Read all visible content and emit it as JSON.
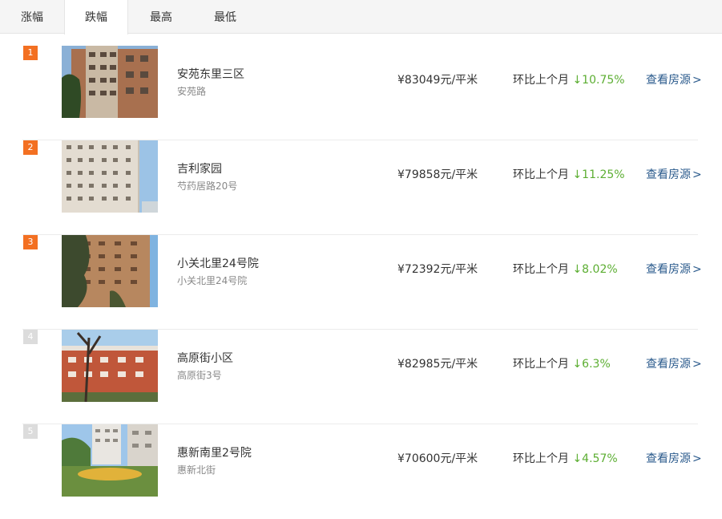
{
  "tabs": [
    {
      "label": "涨幅"
    },
    {
      "label": "跌幅"
    },
    {
      "label": "最高"
    },
    {
      "label": "最低"
    }
  ],
  "trend_prefix": "环比上个月",
  "link_label": "查看房源",
  "link_icon": "chevron-right-icon",
  "colors": {
    "rank_top": "#f37022",
    "rank_rest": "#dcdcdc",
    "decline": "#5cae32",
    "link": "#2a5a8c"
  },
  "rows": [
    {
      "rank": "1",
      "name": "安苑东里三区",
      "address": "安苑路",
      "price": "¥83049元/平米",
      "change": "↓10.75%"
    },
    {
      "rank": "2",
      "name": "吉利家园",
      "address": "芍药居路20号",
      "price": "¥79858元/平米",
      "change": "↓11.25%"
    },
    {
      "rank": "3",
      "name": "小关北里24号院",
      "address": "小关北里24号院",
      "price": "¥72392元/平米",
      "change": "↓8.02%"
    },
    {
      "rank": "4",
      "name": "高原街小区",
      "address": "高原街3号",
      "price": "¥82985元/平米",
      "change": "↓6.3%"
    },
    {
      "rank": "5",
      "name": "惠新南里2号院",
      "address": "惠新北街",
      "price": "¥70600元/平米",
      "change": "↓4.57%"
    }
  ]
}
